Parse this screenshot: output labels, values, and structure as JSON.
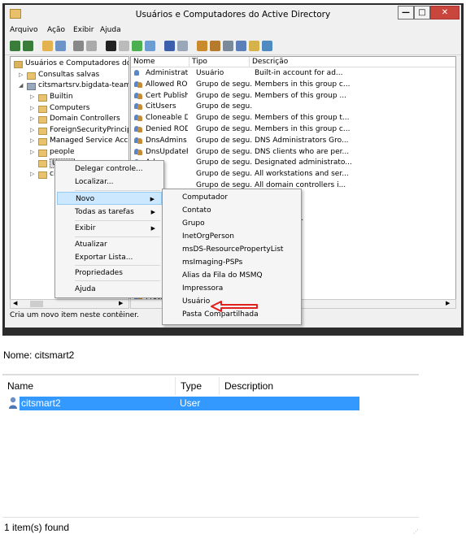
{
  "window": {
    "title": "Usuários e Computadores do Active Directory",
    "buttons": {
      "minimize": "—",
      "maximize": "□",
      "close": "✕"
    }
  },
  "menubar": [
    "Arquivo",
    "Ação",
    "Exibir",
    "Ajuda"
  ],
  "tree": {
    "items": [
      {
        "label": "Usuários e Computadores do Ac"
      },
      {
        "label": "Consultas salvas"
      },
      {
        "label": "citsmartsrv.bigdata-team.co"
      },
      {
        "label": "Builtin"
      },
      {
        "label": "Computers"
      },
      {
        "label": "Domain Controllers"
      },
      {
        "label": "ForeignSecurityPrincipals"
      },
      {
        "label": "Managed Service Accoun"
      },
      {
        "label": "people"
      },
      {
        "label": "Users"
      },
      {
        "label": "cit"
      }
    ]
  },
  "list": {
    "columns": [
      "Nome",
      "Tipo",
      "Descrição"
    ],
    "rows": [
      {
        "name": "Administrator",
        "type": "Usuário",
        "desc": "Built-in account for ad..."
      },
      {
        "name": "Allowed RO...",
        "type": "Grupo de segu...",
        "desc": "Members in this group c..."
      },
      {
        "name": "Cert Publish...",
        "type": "Grupo de segu...",
        "desc": "Members of this group ..."
      },
      {
        "name": "CitUsers",
        "type": "Grupo de segu...",
        "desc": ""
      },
      {
        "name": "Cloneable D...",
        "type": "Grupo de segu...",
        "desc": "Members of this group t..."
      },
      {
        "name": "Denied ROD...",
        "type": "Grupo de segu...",
        "desc": "Members in this group c..."
      },
      {
        "name": "DnsAdmins",
        "type": "Grupo de segu...",
        "desc": "DNS Administrators Gro..."
      },
      {
        "name": "DnsUpdateP...",
        "type": "Grupo de segu...",
        "desc": "DNS clients who are per..."
      },
      {
        "name": "Ad...",
        "type": "Grupo de segu...",
        "desc": "Designated administrato..."
      },
      {
        "name": "Co...",
        "type": "Grupo de segu...",
        "desc": "All workstations and ser..."
      },
      {
        "name": "Co...",
        "type": "Grupo de segu...",
        "desc": "All domain controllers i..."
      },
      {
        "name": "",
        "type": "",
        "desc": "ts"
      },
      {
        "name": "",
        "type": "",
        "desc": ""
      },
      {
        "name": "",
        "type": "",
        "desc": "dministrato..."
      },
      {
        "name": "",
        "type": "",
        "desc": "group ..."
      },
      {
        "name": "",
        "type": "",
        "desc": ""
      },
      {
        "name": "",
        "type": "",
        "desc": "group c..."
      },
      {
        "name": "",
        "type": "",
        "desc": "for gue..."
      },
      {
        "name": "",
        "type": "",
        "desc": ""
      },
      {
        "name": "",
        "type": "",
        "desc": ""
      },
      {
        "name": "Protect",
        "type": "",
        "desc": "group ..."
      }
    ]
  },
  "context_menu": {
    "items": [
      "Delegar controle...",
      "Localizar...",
      "Novo",
      "Todas as tarefas",
      "Exibir",
      "Atualizar",
      "Exportar Lista...",
      "Propriedades",
      "Ajuda"
    ]
  },
  "submenu": {
    "items": [
      "Computador",
      "Contato",
      "Grupo",
      "InetOrgPerson",
      "msDS-ResourcePropertyList",
      "msImaging-PSPs",
      "Alias da Fila do MSMQ",
      "Impressora",
      "Usuário",
      "Pasta Compartilhada"
    ]
  },
  "status_bar": "Cria um novo item neste contêiner.",
  "bottom": {
    "name_label": "Nome: citsmart2",
    "columns": [
      "Name",
      "Type",
      "Description"
    ],
    "row": {
      "name": "citsmart2",
      "type": "User",
      "description": ""
    },
    "footer": "1 item(s) found"
  },
  "colors": {
    "selection": "#3399ff",
    "highlight_arrow": "#e0201b",
    "menu_highlight": "#cce8ff"
  }
}
